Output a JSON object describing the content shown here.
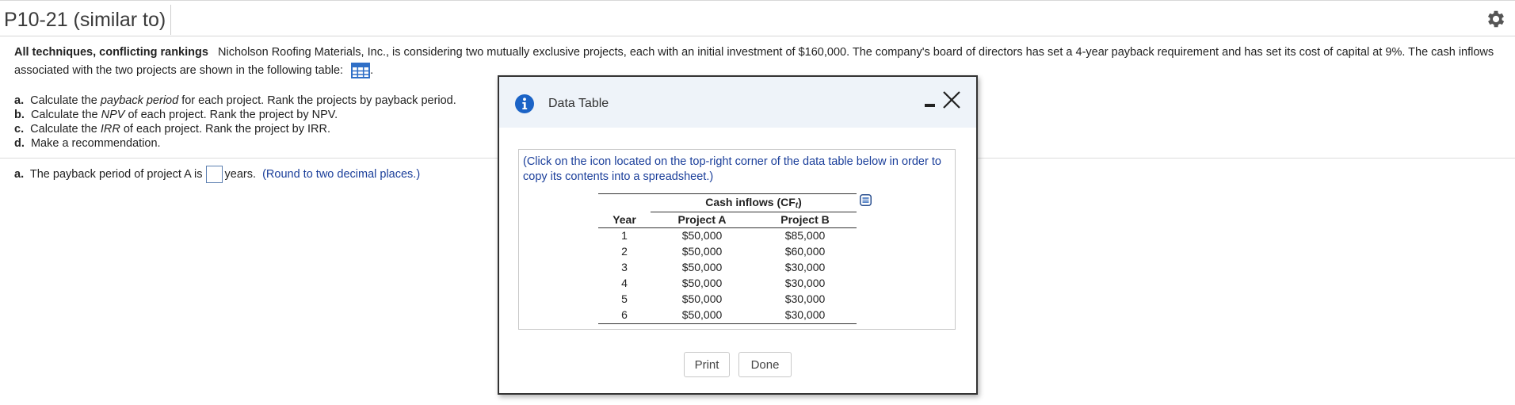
{
  "page": {
    "title": "P10-21 (similar to)",
    "settings_icon": "gear-icon"
  },
  "question": {
    "intro_bold": "All techniques, conflicting rankings",
    "intro_text": "Nicholson Roofing Materials, Inc., is considering two mutually exclusive projects, each with an initial investment of $160,000.  The company's board of directors has set a 4-year payback requirement and has set its cost of capital at 9%.  The cash inflows associated with the two projects are shown in the following table:",
    "table_icon": "table-grid-icon",
    "intro_end": ".",
    "parts": [
      {
        "label": "a.",
        "pre": "Calculate the ",
        "term": "payback period",
        "post": " for each project.  Rank the projects by payback period."
      },
      {
        "label": "b.",
        "pre": "Calculate the ",
        "term": "NPV",
        "post": " of each project.  Rank the project by NPV."
      },
      {
        "label": "c.",
        "pre": "Calculate the ",
        "term": "IRR",
        "post": " of each project.  Rank the project by IRR."
      },
      {
        "label": "d.",
        "pre": "Make a recommendation.",
        "term": "",
        "post": ""
      }
    ],
    "answer": {
      "label": "a.",
      "pre": "The payback period of project A is",
      "value": "",
      "post": "years.",
      "hint": "(Round to two decimal places.)"
    }
  },
  "modal": {
    "title": "Data Table",
    "info_icon": "info-icon",
    "minimize_icon": "minimize-icon",
    "close_icon": "close-icon",
    "note": "(Click on the icon located on the top-right corner of the data table below in order to copy its contents into a spreadsheet.)",
    "copy_icon": "copy-icon",
    "table": {
      "group_header": "Cash inflows (CF",
      "group_header_sub": "t",
      "group_header_end": ")",
      "columns": [
        "Year",
        "Project A",
        "Project B"
      ],
      "rows": [
        [
          "1",
          "$50,000",
          "$85,000"
        ],
        [
          "2",
          "$50,000",
          "$60,000"
        ],
        [
          "3",
          "$50,000",
          "$30,000"
        ],
        [
          "4",
          "$50,000",
          "$30,000"
        ],
        [
          "5",
          "$50,000",
          "$30,000"
        ],
        [
          "6",
          "$50,000",
          "$30,000"
        ]
      ]
    },
    "buttons": {
      "print": "Print",
      "done": "Done"
    }
  }
}
